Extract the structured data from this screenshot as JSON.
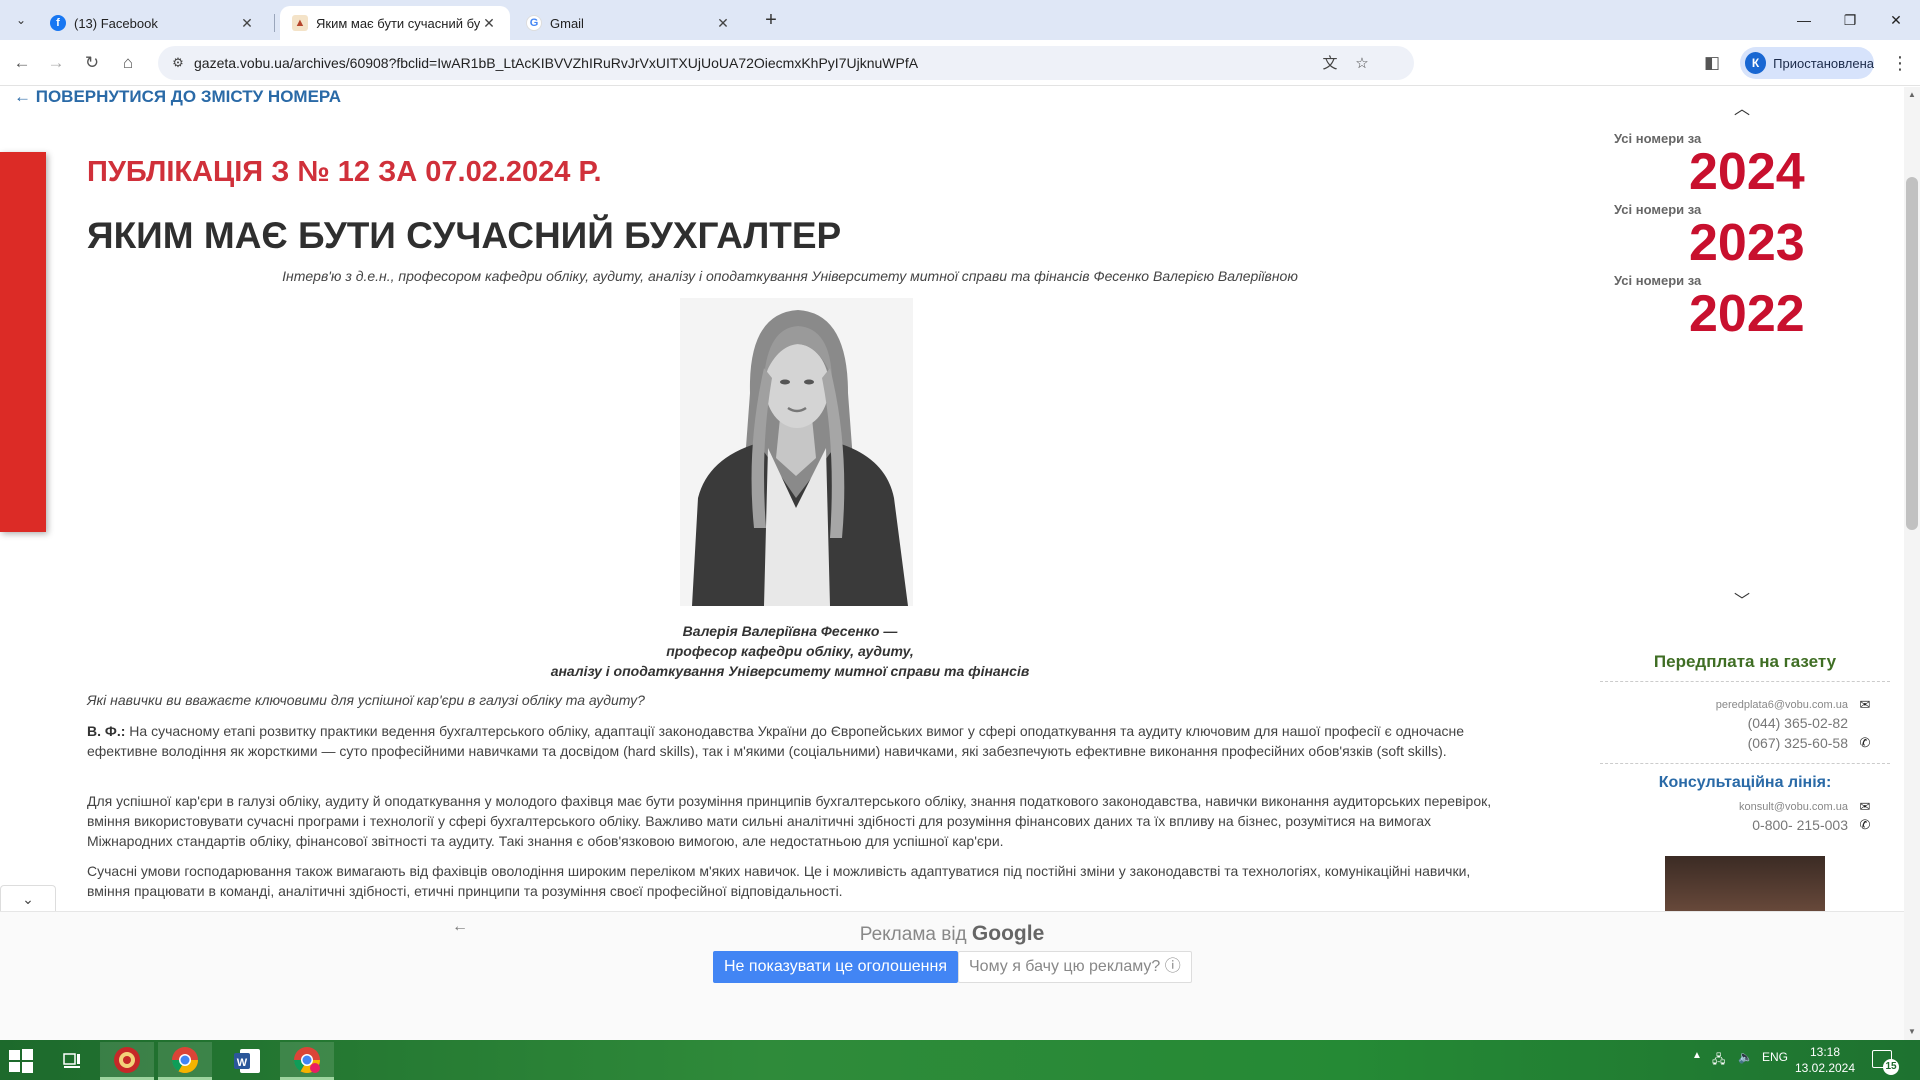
{
  "browser": {
    "tabs": [
      {
        "title": "(13) Facebook",
        "favicon": "facebook-icon"
      },
      {
        "title": "Яким має бути сучасний бухгалтер",
        "favicon": "site-icon"
      },
      {
        "title": "Gmail",
        "favicon": "google-icon"
      }
    ],
    "url": "gazeta.vobu.ua/archives/60908?fbclid=IwAR1bB_LtAcKIBVVZhIRuRvJrVxUITXUjUoUA72OiecmxKhPyI7UjknuWPfA",
    "profile_initial": "К",
    "profile_label": "Приостановлена"
  },
  "page": {
    "back_link": "← ПОВЕРНУТИСЯ ДО ЗМІСТУ НОМЕРА",
    "publication_line": "ПУБЛІКАЦІЯ З № 12 ЗА 07.02.2024 Р.",
    "headline": "ЯКИМ МАЄ БУТИ СУЧАСНИЙ БУХГАЛТЕР",
    "intro": "Інтерв'ю з д.е.н., професором кафедри обліку, аудиту, аналізу і оподаткування Університету митної справи та фінансів Фесенко Валерією Валеріївною",
    "caption": [
      "Валерія Валеріївна Фесенко —",
      "професор кафедри обліку, аудиту,",
      "аналізу і оподаткування Університету митної справи та фінансів"
    ],
    "question": "Які навички ви вважаєте ключовими для успішної кар'єри в галузі обліку та аудиту?",
    "answer_prefix": "В. Ф.:",
    "paragraphs": [
      "На сучасному етапі розвитку практики ведення бухгалтерського обліку, адаптації законодавства України до Європейських вимог у сфері оподаткування та аудиту ключовим для нашої професії є одночасне ефективне володіння як жорсткими — суто професійними навичками та досвідом (hard skills), так і м'якими (соціальними) навичками, які забезпечують ефективне виконання професійних обов'язків (soft skills).",
      "Для успішної кар'єри в галузі обліку, аудиту й оподаткування у молодого фахівця має бути  розуміння принципів бухгалтерського обліку, знання податкового законодавства, навички виконання аудиторських перевірок, вміння використовувати сучасні програми і технології у сфері бухгалтерського обліку. Важливо мати сильні аналітичні здібності для розуміння фінансових даних та їх впливу на бізнес, розумітися на вимогах Міжнародних стандартів обліку, фінансової звітності та аудиту. Такі знання є обов'язковою вимогою, але недостатньою для успішної кар'єри.",
      "Сучасні умови господарювання також вимагають від фахівців оволодіння широким переліком м'яких навичок. Це і можливість адаптуватися під постійні зміни у законодавстві та технологіях, комунікаційні навички, вміння працювати в команді, аналітичні здібності, етичні принципи та розуміння своєї професійної відповідальності."
    ]
  },
  "sidebar": {
    "issues": [
      {
        "label": "Усі номери за",
        "year": "2024"
      },
      {
        "label": "Усі номери за",
        "year": "2023"
      },
      {
        "label": "Усі номери за",
        "year": "2022"
      }
    ],
    "subscription_title": "Передплата на газету",
    "subscription_email": "peredplata6@vobu.com.ua",
    "subscription_phone_1": "(044) 365-02-82",
    "subscription_phone_2": "(067) 325-60-58",
    "consult_title": "Консультаційна лінія:",
    "consult_email": "konsult@vobu.com.ua",
    "consult_phone": "0-800- 215-003"
  },
  "ad": {
    "label_prefix": "Реклама від",
    "label_brand": "Google",
    "hide_button": "Не показувати це оголошення",
    "why_button": "Чому я бачу цю рекламу? ⓘ"
  },
  "taskbar": {
    "language": "ENG",
    "time": "13:18",
    "date": "13.02.2024",
    "notifications": "15"
  },
  "colors": {
    "accent_red": "#d0303a",
    "year_red": "#c8102e",
    "link_blue": "#2a6aa7",
    "subscription_green": "#3f6e24",
    "ad_blue": "#4285f4"
  }
}
